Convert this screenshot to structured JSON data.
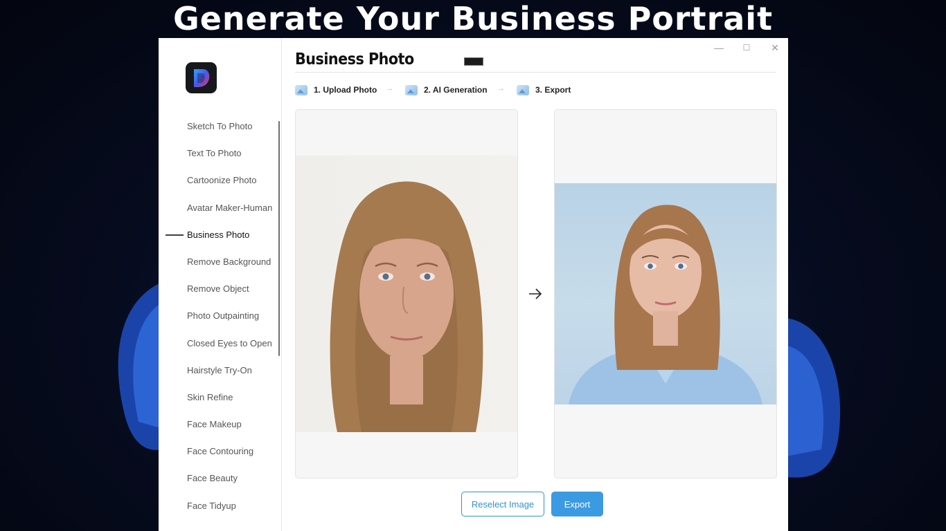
{
  "banner": {
    "title": "Generate Your Business Portrait"
  },
  "window": {
    "minimize_glyph": "—",
    "maximize_glyph": "☐",
    "close_glyph": "✕"
  },
  "sidebar": {
    "logo_icon": "app-logo-icon",
    "items": [
      {
        "label": "Sketch To Photo",
        "active": false
      },
      {
        "label": "Text To Photo",
        "active": false
      },
      {
        "label": "Cartoonize Photo",
        "active": false
      },
      {
        "label": "Avatar Maker-Human",
        "active": false
      },
      {
        "label": "Business Photo",
        "active": true
      },
      {
        "label": "Remove Background",
        "active": false
      },
      {
        "label": "Remove Object",
        "active": false
      },
      {
        "label": "Photo Outpainting",
        "active": false
      },
      {
        "label": "Closed Eyes to Open",
        "active": false
      },
      {
        "label": "Hairstyle Try-On",
        "active": false
      },
      {
        "label": "Skin Refine",
        "active": false
      },
      {
        "label": "Face Makeup",
        "active": false
      },
      {
        "label": "Face Contouring",
        "active": false
      },
      {
        "label": "Face Beauty",
        "active": false
      },
      {
        "label": "Face Tidyup",
        "active": false
      }
    ]
  },
  "main": {
    "title": "Business Photo",
    "steps": [
      {
        "label": "1. Upload Photo",
        "icon": "image-icon"
      },
      {
        "label": "2. AI Generation",
        "icon": "image-icon"
      },
      {
        "label": "3. Export",
        "icon": "image-icon"
      }
    ],
    "step_separator": "→",
    "input_panel": {
      "icon": "uploaded-photo-image"
    },
    "output_panel": {
      "icon": "generated-business-portrait-image"
    },
    "arrow_icon": "arrow-right-icon",
    "buttons": {
      "reselect_label": "Reselect Image",
      "export_label": "Export"
    }
  },
  "colors": {
    "accent": "#3b9ae1",
    "output_background": "#bcd3e6"
  }
}
